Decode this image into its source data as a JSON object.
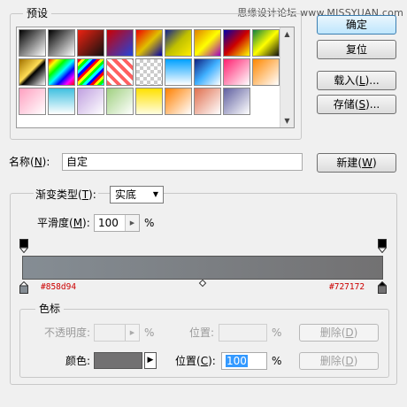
{
  "watermark": "思缘设计论坛 www.MISSYUAN.com",
  "presets": {
    "title": "预设",
    "swatches": [
      "linear-gradient(135deg,#000 0%,#fff 100%)",
      "linear-gradient(135deg,#000 0%,rgba(255,255,255,0.4) 100%)",
      "linear-gradient(135deg,#e21 0%,#111 100%)",
      "linear-gradient(135deg,#c00 0%,#2244dd 100%)",
      "linear-gradient(135deg,#e00 0%,#e0c000 50%,#00a 100%)",
      "linear-gradient(135deg,#102090 0%,#c0c000 50%,#ffee00 100%)",
      "linear-gradient(135deg,#e08000 0%,#ff0 50%,#a000c0 100%)",
      "linear-gradient(135deg,#00a 0%,#c00 50%,#ff0 100%)",
      "linear-gradient(135deg,#108040 0%,#ff0 50%,#111 100%)",
      "linear-gradient(135deg,#a07000 0%,#ffdd55 45%,#000 55%,#fff 100%)",
      "linear-gradient(135deg,#f00,#ff0,#0f0,#0ff,#00f,#f0f,#f00)",
      "repeating-linear-gradient(135deg,#f00 0 3px,#ff0 3px 6px,#0f0 6px 9px,#0ff 9px 12px,#00f 12px 15px)",
      "repeating-linear-gradient(45deg,#ff6060 0 4px,#fff 4px 8px)",
      "repeating-conic-gradient(#ccc 0% 25%,#fff 0% 50%) 0 0/8px 8px",
      "linear-gradient(#00a0ff,#fff)",
      "linear-gradient(135deg,#102080 0%,#40b0ff 50%,#fff 100%)",
      "linear-gradient(135deg,#ff2070 0%,#fff 100%)",
      "linear-gradient(135deg,#ff8800 0%,#fff 100%)",
      "linear-gradient(135deg,#ffa0c0 0%,#fff 100%)",
      "linear-gradient(#40c0e0,#fff)",
      "linear-gradient(135deg,#c0a0e0 0%,#fff 100%)",
      "linear-gradient(135deg,#a0d080 0%,#fff 100%)",
      "linear-gradient(#ffe000,#fffde0)",
      "linear-gradient(135deg,#ff8000 0%,#fff 100%)",
      "linear-gradient(135deg,#e07050 0%,#fff 100%)",
      "linear-gradient(135deg,#6060a0 0%,#fff 100%)"
    ]
  },
  "buttons": {
    "ok": "确定",
    "reset": "复位",
    "load_prefix": "载入(",
    "load_key": "L",
    "load_suffix": ")...",
    "save_prefix": "存储(",
    "save_key": "S",
    "save_suffix": ")...",
    "new_prefix": "新建(",
    "new_key": "W",
    "new_suffix": ")"
  },
  "name_row": {
    "label_prefix": "名称(",
    "label_key": "N",
    "label_suffix": "):",
    "value": "自定"
  },
  "gradient_type": {
    "label_prefix": "渐变类型(",
    "label_key": "T",
    "label_suffix": "):",
    "selected": "实底"
  },
  "smoothness": {
    "label_prefix": "平滑度(",
    "label_key": "M",
    "label_suffix": "):",
    "value": "100",
    "unit": "%"
  },
  "gradient": {
    "color_left": "#858d94",
    "color_right": "#727172",
    "midpoint_position": 0.5,
    "label_left": "#858d94",
    "label_right": "#727172",
    "label_color": "#cc0000"
  },
  "color_stops": {
    "title": "色标",
    "opacity_label_prefix": "不透明度",
    "opacity_label_suffix": ":",
    "opacity_unit": "%",
    "opacity_position_label": "位置:",
    "opacity_position_unit": "%",
    "delete_prefix": "删除(",
    "delete_key": "D",
    "delete_suffix": ")",
    "color_label": "颜色:",
    "color_value": "#727172",
    "position_label_prefix": "位置(",
    "position_label_key": "C",
    "position_label_suffix": "):",
    "position_value": "100",
    "position_unit": "%"
  }
}
